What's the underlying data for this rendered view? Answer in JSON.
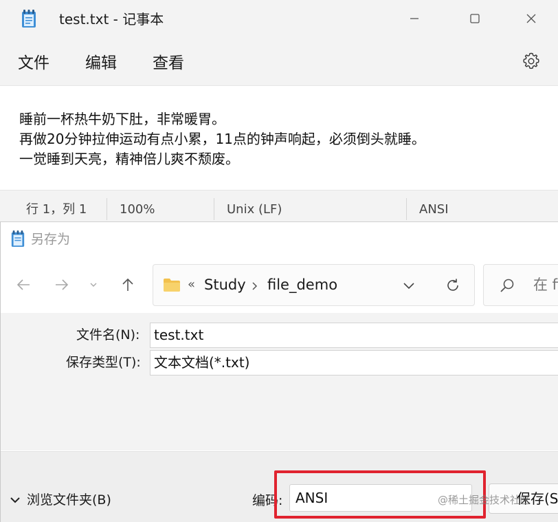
{
  "notepad": {
    "title": "test.txt - 记事本",
    "menu": [
      "文件",
      "编辑",
      "查看"
    ],
    "content_lines": [
      "睡前一杯热牛奶下肚，非常暖胃。",
      "再做20分钟拉伸运动有点小累，11点的钟声响起，必须倒头就睡。",
      "一觉睡到天亮，精神倍儿爽不颓废。"
    ],
    "status": {
      "position": "行 1，列 1",
      "zoom": "100%",
      "line_ending": "Unix (LF)",
      "encoding": "ANSI"
    }
  },
  "save_dialog": {
    "title": "另存为",
    "breadcrumb_prefix": "«",
    "breadcrumb": [
      "Study",
      "file_demo"
    ],
    "search_placeholder": "在 fi",
    "filename_label": "文件名(N):",
    "filename_value": "test.txt",
    "filetype_label": "保存类型(T):",
    "filetype_value": "文本文档(*.txt)",
    "browse_folders_label": "浏览文件夹(B)",
    "encoding_label": "编码:",
    "encoding_value": "ANSI",
    "save_label": "保存(S"
  },
  "watermark": "@稀土掘金技术社区",
  "colors": {
    "highlight": "#e0232f",
    "window_bg": "#f3f3f3",
    "folder": "#f2c14e"
  }
}
